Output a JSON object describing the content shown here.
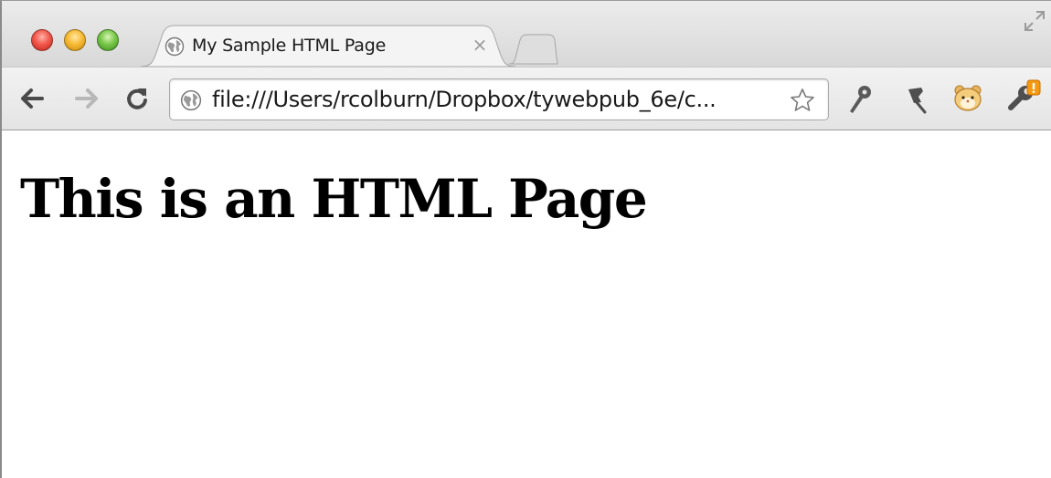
{
  "window": {
    "buttons": [
      "close",
      "minimize",
      "zoom"
    ]
  },
  "tabs": [
    {
      "title": "My Sample HTML Page",
      "icon": "globe-icon",
      "close": "×",
      "active": true
    }
  ],
  "toolbar": {
    "address": "file:///Users/rcolburn/Dropbox/tywebpub_6e/c...",
    "icons": [
      "back-arrow-icon",
      "forward-arrow-icon",
      "reload-icon",
      "globe-icon",
      "bookmark-star-icon",
      "pushpin-key-icon",
      "pin-icon",
      "hamster-icon",
      "wrench-icon"
    ]
  },
  "page": {
    "heading": "This is an HTML Page"
  },
  "colors": {
    "close": "#f2584c",
    "minimize": "#f7bb35",
    "zoom": "#79c84a",
    "wrench_badge": "#f59a10"
  }
}
